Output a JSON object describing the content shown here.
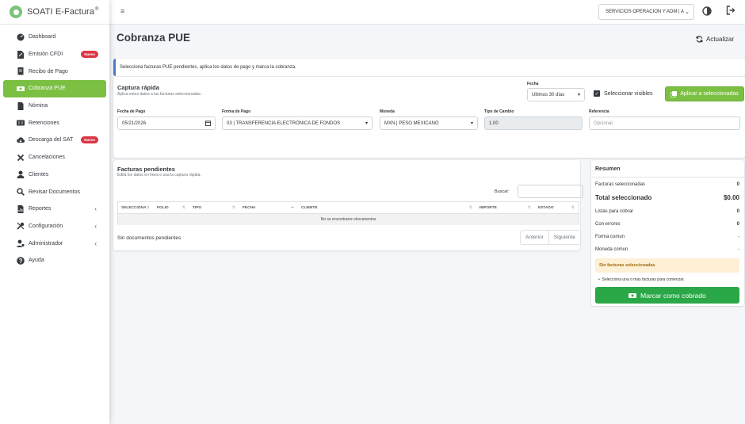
{
  "brand": {
    "name": "SOATI E-Factura",
    "reg": "®"
  },
  "sidebar": {
    "items": [
      {
        "label": "Dashboard"
      },
      {
        "label": "Emisión CFDI",
        "badge": "Nuevo"
      },
      {
        "label": "Recibo de Pago"
      },
      {
        "label": "Cobranza PUE"
      },
      {
        "label": "Nómina"
      },
      {
        "label": "Retenciones"
      },
      {
        "label": "Descarga del SAT",
        "badge": "Nuevo"
      },
      {
        "label": "Cancelaciones"
      },
      {
        "label": "Clientes"
      },
      {
        "label": "Revisar Documentos"
      },
      {
        "label": "Reportes",
        "chevron": "‹"
      },
      {
        "label": "Configuración",
        "chevron": "‹"
      },
      {
        "label": "Administrador",
        "chevron": "‹"
      },
      {
        "label": "Ayuda"
      }
    ]
  },
  "topbar": {
    "menu_icon": "≡",
    "company_selected": "SERVICIOS OPERACION Y ADM | A",
    "company_caret": "⌄"
  },
  "page": {
    "title": "Cobranza PUE",
    "refresh_label": "Actualizar",
    "info_text": "Selecciona facturas PUE pendientes, aplica los datos de pago y marca la cobranza."
  },
  "quick_capture": {
    "title": "Captura rápida",
    "subtitle": "Aplica estos datos a las facturas seleccionadas.",
    "fecha_label": "Fecha",
    "fecha_filter": "Ultimos 30 días",
    "select_visible_label": "Seleccionar visibles",
    "apply_label": "Aplicar a seleccionadas",
    "fecha_pago_label": "Fecha de Pago",
    "fecha_pago_value": "05/21/2026",
    "forma_pago_label": "Forma de Pago",
    "forma_pago_value": "03 | TRANSFERENCIA ELECTRÓNICA DE FONDOS",
    "moneda_label": "Moneda",
    "moneda_value": "MXN | PESO MEXICANO",
    "tipo_cambio_label": "Tipo de Cambio",
    "tipo_cambio_value": "1.00",
    "referencia_label": "Referencia",
    "referencia_placeholder": "Opcional"
  },
  "pending": {
    "title": "Facturas pendientes",
    "subtitle": "Edita los datos en línea o usa la captura rápida.",
    "search_label": "Buscar:",
    "columns": [
      "SELECCIONA",
      "FOLIO",
      "TIPO",
      "FECHA",
      "CLIENTE",
      "IMPORTE",
      "ESTADO"
    ],
    "empty_text": "No se encontraron documentos",
    "info": "Sin documentos pendientes",
    "prev": "Anterior",
    "next": "Siguiente"
  },
  "summary": {
    "title": "Resumen",
    "rows": [
      {
        "label": "Facturas seleccionadas",
        "value": "0"
      },
      {
        "label": "Total seleccionado",
        "value": "$0.00"
      },
      {
        "label": "Listas para cobrar",
        "value": "0"
      },
      {
        "label": "Con errores",
        "value": "0"
      },
      {
        "label": "Forma comun",
        "value": "-"
      },
      {
        "label": "Moneda comun",
        "value": "-"
      }
    ],
    "alert": "Sin facturas seleccionadas",
    "hint": "Selecciona una o mas facturas para comenzar.",
    "button": "Marcar como cobrado"
  },
  "colors": {
    "accent": "#7cc043",
    "success": "#2aa746",
    "info_border": "#4a7bd0",
    "badge": "#dc3545"
  }
}
